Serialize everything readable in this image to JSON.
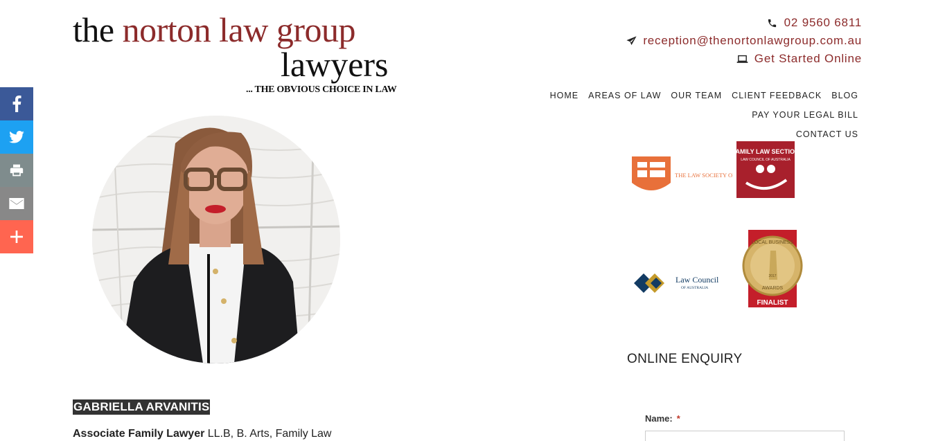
{
  "logo": {
    "line1_the": "the",
    "line1_rest": "norton law group",
    "line2": "lawyers",
    "tagline": "... THE OBVIOUS CHOICE IN LAW"
  },
  "contact": {
    "phone": "02 9560 6811",
    "email": "reception@thenortonlawgroup.com.au",
    "cta": "Get Started Online",
    "accent_color": "#8c2b2b"
  },
  "nav": {
    "items": [
      "HOME",
      "AREAS OF LAW",
      "OUR TEAM",
      "CLIENT FEEDBACK",
      "BLOG",
      "PAY YOUR LEGAL BILL",
      "CONTACT US"
    ]
  },
  "share": {
    "icons": [
      "facebook-icon",
      "twitter-icon",
      "print-icon",
      "email-icon",
      "more-icon"
    ],
    "colors": [
      "#3b5998",
      "#1da1f2",
      "#7f8c8d",
      "#888888",
      "#ff6550"
    ]
  },
  "profile": {
    "name": "GABRIELLA ARVANITIS",
    "role_title": "Associate Family Lawyer",
    "role_detail": " LL.B, B. Arts, Family Law"
  },
  "badges": {
    "law_society": "THE LAW SOCIETY OF NEW SOUTH WALES",
    "family_law_section": "FAMILY LAW SECTION",
    "family_law_sub": "LAW COUNCIL OF AUSTRALIA",
    "law_council": "Law Council",
    "law_council_sub": "OF AUSTRALIA",
    "local_business_top": "LOCAL BUSINESS",
    "local_business_year": "2017",
    "local_business_awards": "AWARDS",
    "local_business_finalist": "FINALIST"
  },
  "enquiry": {
    "title": "ONLINE ENQUIRY",
    "name_label": "Name:",
    "required_mark": "*"
  }
}
